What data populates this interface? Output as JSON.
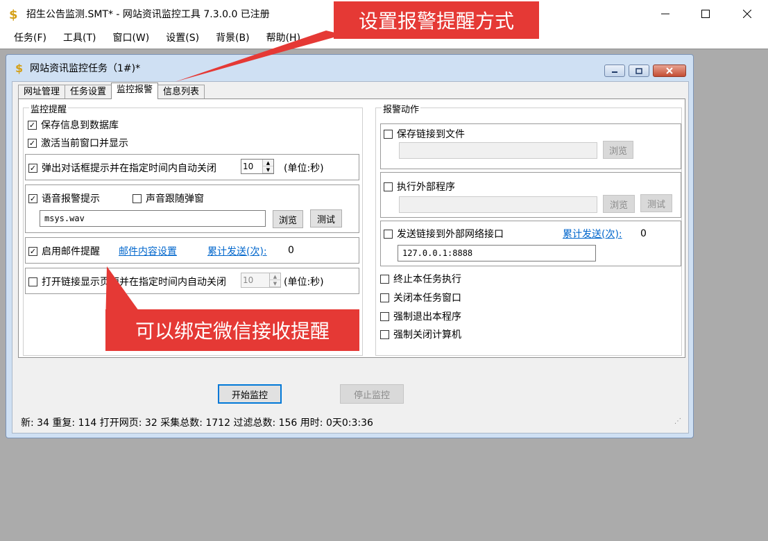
{
  "window": {
    "title": "招生公告监测.SMT* - 网站资讯监控工具 7.3.0.0  已注册"
  },
  "menu": [
    "任务(F)",
    "工具(T)",
    "窗口(W)",
    "设置(S)",
    "背景(B)",
    "帮助(H)"
  ],
  "child": {
    "title": "网站资讯监控任务（1#)*",
    "tabs": [
      "网址管理",
      "任务设置",
      "监控报警",
      "信息列表"
    ],
    "active_tab": "监控报警"
  },
  "monitor": {
    "group_title": "监控提醒",
    "save_db": {
      "label": "保存信息到数据库",
      "checked": true
    },
    "activate": {
      "label": "激活当前窗口并显示",
      "checked": true
    },
    "dialog": {
      "label": "弹出对话框提示并在指定时间内自动关闭",
      "checked": true,
      "seconds": "10",
      "unit": "(单位:秒)"
    },
    "voice": {
      "label": "语音报警提示",
      "checked": true,
      "follow_label": "声音跟随弹窗",
      "follow_checked": false,
      "file": "msys.wav",
      "browse": "浏览",
      "test": "测试"
    },
    "email": {
      "label": "启用邮件提醒",
      "checked": true,
      "settings_link": "邮件内容设置",
      "count_link": "累计发送(次):",
      "count": "0"
    },
    "open_link": {
      "label": "打开链接显示页面并在指定时间内自动关闭",
      "checked": false,
      "seconds": "10",
      "unit": "(单位:秒)"
    }
  },
  "actions": {
    "group_title": "报警动作",
    "save_file": {
      "label": "保存链接到文件",
      "checked": false,
      "browse": "浏览"
    },
    "run_program": {
      "label": "执行外部程序",
      "checked": false,
      "browse": "浏览",
      "test": "测试"
    },
    "send_net": {
      "label": "发送链接到外部网络接口",
      "checked": false,
      "count_link": "累计发送(次):",
      "count": "0",
      "address": "127.0.0.1:8888"
    },
    "stop_task": {
      "label": "终止本任务执行",
      "checked": false
    },
    "close_window": {
      "label": "关闭本任务窗口",
      "checked": false
    },
    "exit_app": {
      "label": "强制退出本程序",
      "checked": false
    },
    "shutdown": {
      "label": "强制关闭计算机",
      "checked": false
    }
  },
  "buttons": {
    "start": "开始监控",
    "stop": "停止监控"
  },
  "status": "新: 34  重复: 114  打开网页: 32  采集总数: 1712  过滤总数: 156  用时: 0天0:3:36",
  "callouts": {
    "top": "设置报警提醒方式",
    "bottom": "可以绑定微信接收提醒"
  },
  "colors": {
    "callout": "#e53935",
    "link": "#0066cc",
    "mdi_background": "#ababab"
  }
}
